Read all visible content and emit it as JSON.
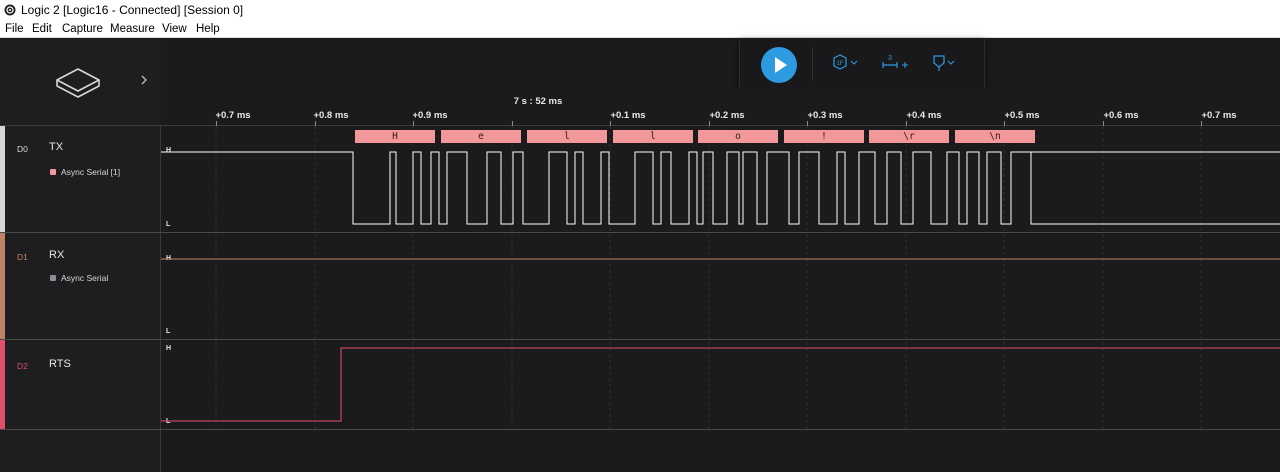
{
  "window": {
    "title": "Logic 2 [Logic16 - Connected] [Session 0]"
  },
  "menu": {
    "items": [
      "File",
      "Edit",
      "Capture",
      "Measure",
      "View",
      "Help"
    ]
  },
  "timeline": {
    "center_time": "7 s : 52 ms",
    "ticks": [
      "+0.7 ms",
      "+0.8 ms",
      "+0.9 ms",
      "+0.1 ms",
      "+0.2 ms",
      "+0.3 ms",
      "+0.4 ms",
      "+0.5 ms",
      "+0.6 ms",
      "+0.7 ms"
    ]
  },
  "toolbar": {
    "play_icon": "play-icon",
    "trigger_icon": "trigger-icon",
    "trigger_label": "1F",
    "measure_icon": "measure-icon",
    "measure_label": "3",
    "marker_icon": "marker-icon",
    "accent": "#2d9be0"
  },
  "channels": [
    {
      "index": "D0",
      "name": "TX",
      "analyzer": "Async Serial [1]",
      "color": "#d6d6d6",
      "dot_color": "#f2989a",
      "level_high": "H",
      "level_low": "L"
    },
    {
      "index": "D1",
      "name": "RX",
      "analyzer": "Async Serial",
      "color": "#c08264",
      "dot_color": "#8a8f9a",
      "level_high": "H",
      "level_low": "L"
    },
    {
      "index": "D2",
      "name": "RTS",
      "analyzer": "",
      "color": "#e0506a",
      "dot_color": "",
      "level_high": "H",
      "level_low": "L"
    }
  ],
  "decoded_frames": [
    "H",
    "e",
    "l",
    "l",
    "o",
    "!",
    "\\r",
    "\\n"
  ],
  "colors": {
    "frame_bg": "#f2989a",
    "tx_wave": "#ffffff",
    "rx_wave": "#c08264",
    "rts_wave": "#e0506a"
  }
}
